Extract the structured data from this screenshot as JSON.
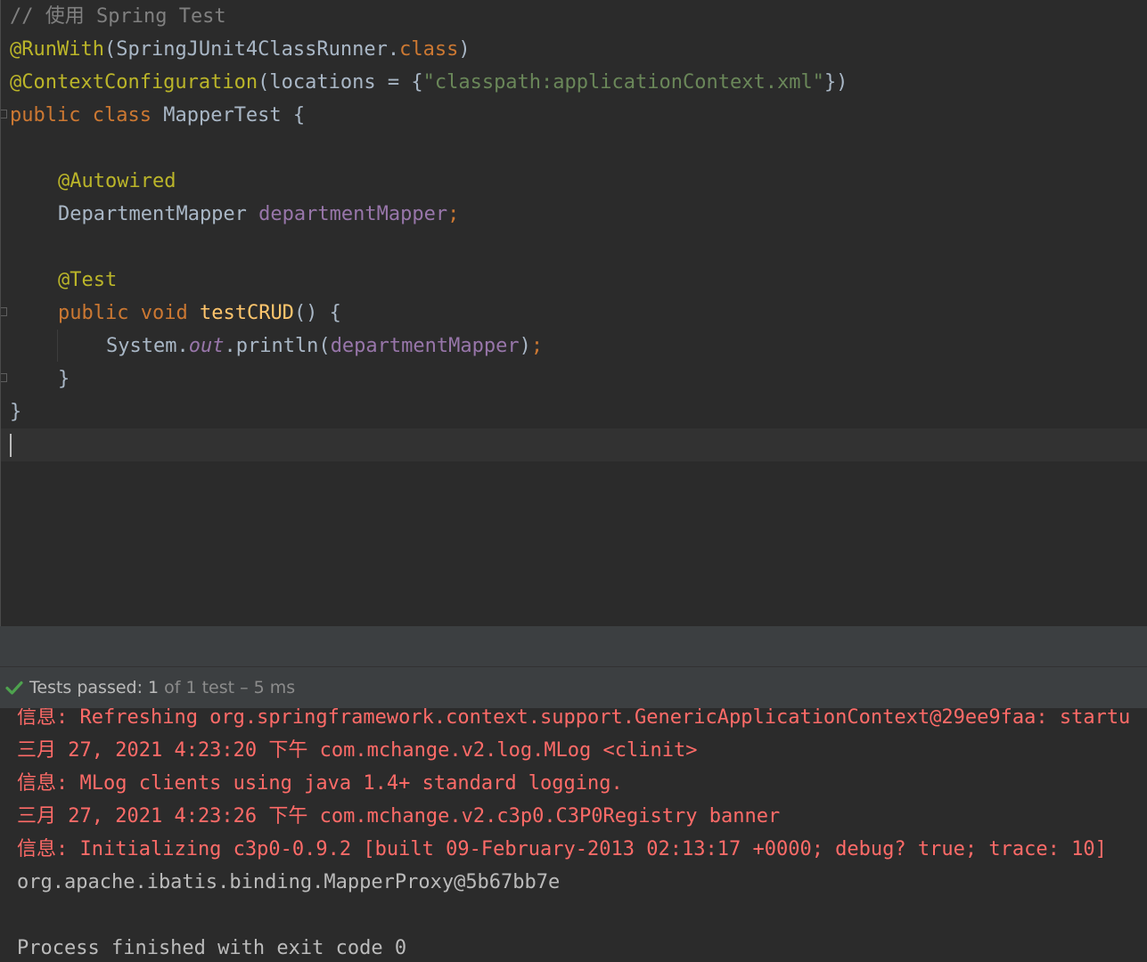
{
  "editor": {
    "comment": "// 使用 Spring Test",
    "runwith_annot": "@RunWith",
    "runwith_arg": "(SpringJUnit4ClassRunner.",
    "runwith_class": "class",
    "runwith_close": ")",
    "context_annot": "@ContextConfiguration",
    "context_open": "(locations = {",
    "context_str": "\"classpath:applicationContext.xml\"",
    "context_close": "})",
    "kw_public": "public",
    "kw_class": "class",
    "class_name": "MapperTest {",
    "autowired_annot": "@Autowired",
    "field_type": "DepartmentMapper",
    "field_name": "departmentMapper",
    "semicolon": ";",
    "test_annot": "@Test",
    "kw_void": "void",
    "method_name": "testCRUD",
    "method_tail": "() {",
    "sys_prefix": "System.",
    "sys_out": "out",
    "println_open": ".println(",
    "println_arg": "departmentMapper",
    "println_close": ")",
    "method_close": "}",
    "class_close": "}"
  },
  "test_status": {
    "label": "Tests passed:",
    "count": "1",
    "rest": "of 1 test – 5 ms"
  },
  "console": {
    "lines": [
      "信息: Refreshing org.springframework.context.support.GenericApplicationContext@29ee9faa: startu",
      "三月 27, 2021 4:23:20 下午 com.mchange.v2.log.MLog <clinit>",
      "信息: MLog clients using java 1.4+ standard logging.",
      "三月 27, 2021 4:23:26 下午 com.mchange.v2.c3p0.C3P0Registry banner",
      "信息: Initializing c3p0-0.9.2 [built 09-February-2013 02:13:17 +0000; debug? true; trace: 10]",
      "org.apache.ibatis.binding.MapperProxy@5b67bb7e",
      "",
      "Process finished with exit code 0"
    ]
  },
  "colors": {
    "check": "#4ea24e",
    "error_text": "#ff6b68"
  }
}
